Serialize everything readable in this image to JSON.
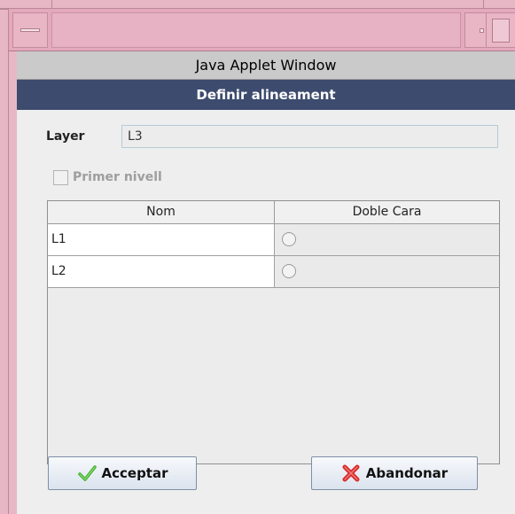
{
  "window": {
    "applet_banner": "Java Applet Window"
  },
  "dialog": {
    "title": "Definir alineament"
  },
  "form": {
    "layer_label": "Layer",
    "layer_value": "L3",
    "first_level_label": "Primer nivell",
    "first_level_checked": false,
    "first_level_enabled": false
  },
  "table": {
    "columns": [
      "Nom",
      "Doble Cara"
    ],
    "rows": [
      {
        "nom": "L1",
        "doble_cara": false
      },
      {
        "nom": "L2",
        "doble_cara": false
      }
    ]
  },
  "buttons": {
    "accept_label": "Acceptar",
    "cancel_label": "Abandonar"
  },
  "icons": {
    "accept": "check-icon",
    "cancel": "cross-icon",
    "window_menu": "window-menu-icon",
    "minimize": "minimize-icon",
    "maximize": "maximize-icon"
  },
  "colors": {
    "frame": "#e8b7c6",
    "header": "#3d4b6e",
    "check": "#3fae2a",
    "cross": "#d82a2a"
  }
}
